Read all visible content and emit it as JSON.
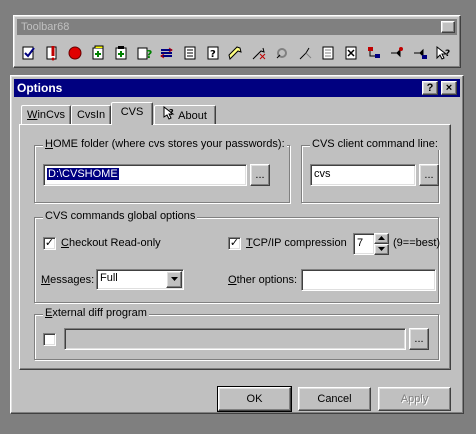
{
  "toolbar": {
    "title": "Toolbar68",
    "close_glyph": "×",
    "icons": [
      "checkout-icon",
      "update-icon",
      "stop-icon",
      "add-icon",
      "add-binary-icon",
      "query-icon",
      "diff-icon",
      "log-icon",
      "status-icon",
      "tag-icon",
      "untag-icon",
      "branch-icon",
      "merge-icon",
      "edit-icon",
      "unedit-icon",
      "graph-icon",
      "watch-on-icon",
      "watch-off-icon",
      "context-help-icon"
    ]
  },
  "dialog": {
    "title": "Options",
    "help_glyph": "?",
    "close_glyph": "×",
    "tabs": [
      {
        "label": "WinCvs",
        "accel": "W",
        "rest": "inCvs"
      },
      {
        "label": "CvsIn",
        "accel": "",
        "rest": "CvsIn"
      },
      {
        "label": "CVS",
        "accel": "",
        "rest": "CVS"
      },
      {
        "label": "About",
        "accel": "",
        "rest": "About"
      }
    ],
    "active_tab": "CVS",
    "home_group": {
      "legend_accel": "H",
      "legend_rest": "OME folder (where cvs stores your passwords):",
      "value": "D:\\CVSHOME",
      "browse_label": "..."
    },
    "client_group": {
      "legend": "CVS client command line:",
      "value": "cvs",
      "browse_label": "..."
    },
    "global_group": {
      "legend": "CVS commands global options",
      "checkout_readonly": {
        "accel": "C",
        "rest": "heckout Read-only",
        "checked": true
      },
      "tcpip": {
        "accel": "T",
        "rest": "CP/IP compression",
        "checked": true
      },
      "compression_value": "7",
      "compression_hint": "(9==best)",
      "messages_label": "Messages:",
      "messages_accel": "M",
      "messages_value": "Full",
      "other_options_label": "Other options:",
      "other_options_accel": "O",
      "other_options_value": ""
    },
    "diff_group": {
      "legend_accel": "E",
      "legend_rest": "xternal diff program",
      "checked": false,
      "value": "",
      "browse_label": "..."
    },
    "buttons": {
      "ok": "OK",
      "cancel": "Cancel",
      "apply": "Apply"
    }
  }
}
